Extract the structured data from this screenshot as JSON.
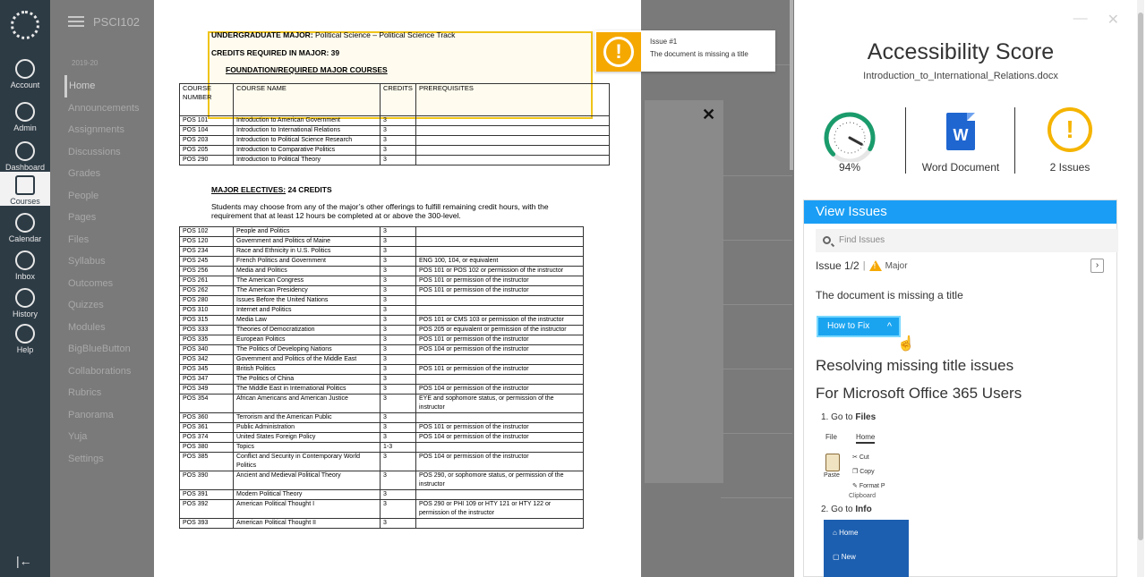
{
  "global_nav": {
    "items": [
      {
        "label": "Account",
        "icon": "user-icon"
      },
      {
        "label": "Admin",
        "icon": "shield-icon"
      },
      {
        "label": "Dashboard",
        "icon": "dashboard-icon"
      },
      {
        "label": "Courses",
        "icon": "book-icon",
        "active": true
      },
      {
        "label": "Calendar",
        "icon": "calendar-icon"
      },
      {
        "label": "Inbox",
        "icon": "inbox-icon"
      },
      {
        "label": "History",
        "icon": "clock-icon"
      },
      {
        "label": "Help",
        "icon": "help-icon"
      }
    ]
  },
  "course": {
    "name": "PSCI102",
    "subheader": "2019-20",
    "nav": [
      "Home",
      "Announcements",
      "Assignments",
      "Discussions",
      "Grades",
      "People",
      "Pages",
      "Files",
      "Syllabus",
      "Outcomes",
      "Quizzes",
      "Modules",
      "BigBlueButton",
      "Collaborations",
      "Rubrics",
      "Panorama",
      "Yuja",
      "Settings"
    ]
  },
  "document": {
    "major_label": "UNDERGRADUATE MAJOR:",
    "major_value": " Political Science – Political Science Track",
    "credits_required": "CREDITS REQUIRED IN MAJOR: 39",
    "foundation_heading": "FOUNDATION/REQUIRED MAJOR COURSES",
    "table_headers": [
      "COURSE NUMBER",
      "COURSE NAME",
      "CREDITS",
      "PREREQUISITES"
    ],
    "required_courses": [
      [
        "POS 101",
        "Introduction to American Government",
        "3",
        ""
      ],
      [
        "POS 104",
        "Introduction to International Relations",
        "3",
        ""
      ],
      [
        "POS 203",
        "Introduction to Political Science Research",
        "3",
        ""
      ],
      [
        "POS 205",
        " Introduction to Comparative Politics",
        "3",
        ""
      ],
      [
        "POS 290",
        "Introduction to Political Theory",
        "3",
        ""
      ]
    ],
    "electives_label": "MAJOR ELECTIVES:",
    "electives_credits": "  24 CREDITS",
    "electives_note_1": "Students may choose from any of the major’s other offerings to fulfill remaining credit hours, with the",
    "electives_note_2": "requirement that at least 12 hours be completed at or above the 300-level.",
    "electives": [
      [
        "POS 102",
        "People and Politics",
        "3",
        ""
      ],
      [
        "POS 120",
        "Government and Politics of Maine",
        "3",
        ""
      ],
      [
        "POS 234",
        "Race and Ethnicity in U.S. Politics",
        "3",
        ""
      ],
      [
        "POS 245",
        "French Politics and Government",
        "3",
        "ENG 100, 104, or equivalent"
      ],
      [
        "POS 256",
        "Media and Politics",
        "3",
        "POS 101 or POS 102 or permission of the instructor"
      ],
      [
        "POS 261",
        "The American Congress",
        "3",
        "POS 101 or permission of the instructor"
      ],
      [
        "POS 262",
        "The American Presidency",
        "3",
        "POS 101 or permission of the instructor"
      ],
      [
        "POS 280",
        "Issues Before the United Nations",
        "3",
        ""
      ],
      [
        "POS 310",
        "Internet and Politics",
        "3",
        ""
      ],
      [
        "POS 315",
        "Media Law",
        "3",
        "POS 101 or CMS 103 or permission of the instructor"
      ],
      [
        "POS 333",
        "Theories of Democratization",
        "3",
        "POS 205 or equivalent or permission of the instructor"
      ],
      [
        "POS 335",
        "European Politics",
        "3",
        "POS 101 or permission of the instructor"
      ],
      [
        "POS 340",
        "The Politics of Developing Nations",
        "3",
        "POS 104 or permission of the instructor"
      ],
      [
        "POS 342",
        "Government and Politics of the Middle East",
        "3",
        ""
      ],
      [
        "POS 345",
        "British Politics",
        "3",
        "POS 101 or permission of the instructor"
      ],
      [
        "POS 347",
        "The Politics of China",
        "3",
        ""
      ],
      [
        "POS 349",
        "The Middle East in International Politics",
        "3",
        "POS 104 or permission of the instructor"
      ],
      [
        "POS 354",
        "African Americans and American Justice",
        "3",
        "EYE and sophomore status, or permission of the instructor"
      ],
      [
        "POS 360",
        "Terrorism and the American Public",
        "3",
        ""
      ],
      [
        "POS 361",
        "Public Administration",
        "3",
        "POS 101 or permission of the instructor"
      ],
      [
        "POS 374",
        "United States Foreign Policy",
        "3",
        "POS 104 or permission of the instructor"
      ],
      [
        "POS 380",
        "Topics",
        "1-3",
        ""
      ],
      [
        "POS 385",
        "Conflict and Security in Contemporary World Politics",
        "3",
        "POS 104 or permission of the instructor"
      ],
      [
        "POS 390",
        "Ancient and Medieval Political Theory",
        "3",
        "POS 290, or sophomore status, or permission of the instructor"
      ],
      [
        "POS 391",
        "Modern Political Theory",
        "3",
        ""
      ],
      [
        "POS 392",
        "American Political Thought I",
        "3",
        "POS 290 or PHI 109 or HTY 121 or HTY 122 or permission of the instructor"
      ],
      [
        "POS 393",
        "American Political Thought II",
        "3",
        ""
      ]
    ]
  },
  "callout": {
    "title": "Issue #1",
    "message": "The document is missing a title"
  },
  "panel": {
    "title": "Accessibility Score",
    "filename": "Introduction_to_International_Relations.docx",
    "score": 0.94,
    "score_label": "94%",
    "doc_type_label": "Word Document",
    "issues_label": "2 Issues",
    "colors": {
      "accent": "#1a9ef5",
      "gauge": "#1a9b6c",
      "warning": "#f5b400"
    },
    "view_issues": "View Issues",
    "find_placeholder": "Find Issues",
    "issue_counter": "Issue 1/2",
    "severity": "Major",
    "issue_description": "The document is missing a title",
    "how_to_fix": "How to Fix",
    "fix_title": "Resolving missing title issues",
    "fix_subtitle": "For Microsoft Office 365 Users",
    "step1_prefix": "1. Go to ",
    "step1_target": "Files",
    "step2_prefix": "2. Go to ",
    "step2_target": "Info",
    "ribbon": {
      "tab_file": "File",
      "tab_home": "Home",
      "paste": "Paste",
      "cut": "Cut",
      "copy": "Copy",
      "format_painter": "Format P",
      "group": "Clipboard"
    },
    "info_menu": [
      "Home",
      "New"
    ]
  }
}
